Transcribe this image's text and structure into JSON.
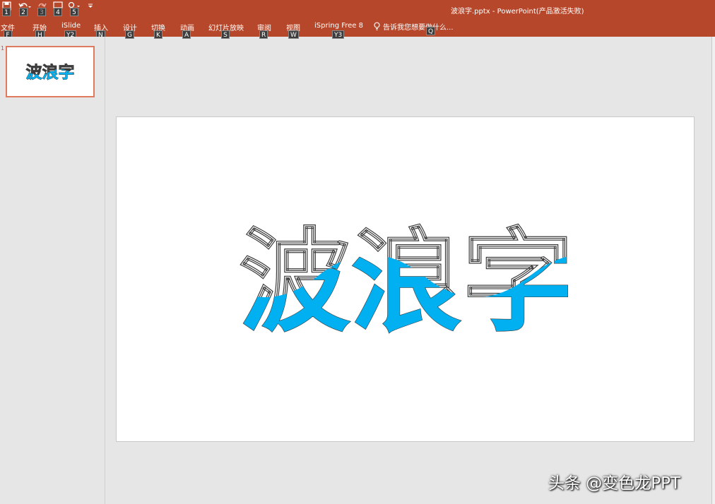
{
  "window": {
    "title": "波浪字.pptx - PowerPoint(产品激活失败)"
  },
  "quick_access": [
    {
      "icon": "save-icon",
      "keytip": "1"
    },
    {
      "icon": "undo-icon",
      "keytip": "2"
    },
    {
      "icon": "redo-icon",
      "keytip": "3"
    },
    {
      "icon": "start-from-beginning-icon",
      "keytip": "4"
    },
    {
      "icon": "touch-mode-icon",
      "keytip": "5"
    }
  ],
  "ribbon_tabs": [
    {
      "label": "文件",
      "keytip": "F"
    },
    {
      "label": "开始",
      "keytip": "H"
    },
    {
      "label": "iSlide",
      "keytip": "Y2"
    },
    {
      "label": "插入",
      "keytip": "N"
    },
    {
      "label": "设计",
      "keytip": "G"
    },
    {
      "label": "切换",
      "keytip": "K"
    },
    {
      "label": "动画",
      "keytip": "A"
    },
    {
      "label": "幻灯片放映",
      "keytip": "S"
    },
    {
      "label": "审阅",
      "keytip": "R"
    },
    {
      "label": "视图",
      "keytip": "W"
    },
    {
      "label": "iSpring Free 8",
      "keytip": "Y3"
    }
  ],
  "tell_me": {
    "text": "告诉我您想要做什么...",
    "keytip": "Q",
    "icon": "lightbulb-icon"
  },
  "thumbnail": {
    "number": "1",
    "text": "波浪字"
  },
  "slide": {
    "wave_text": "波浪字",
    "fill_color": "#00b0f0",
    "outline_color": "#3a3a3a"
  },
  "watermark": "头条 @变色龙PPT",
  "colors": {
    "ribbon": "#b7472a",
    "thumbnail_border": "#e07a5f"
  }
}
